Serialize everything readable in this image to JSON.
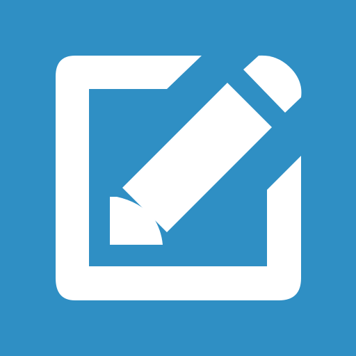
{
  "icon": {
    "name": "edit-note-icon",
    "colors": {
      "background": "#2F8FC4",
      "foreground": "#FFFFFF"
    }
  }
}
